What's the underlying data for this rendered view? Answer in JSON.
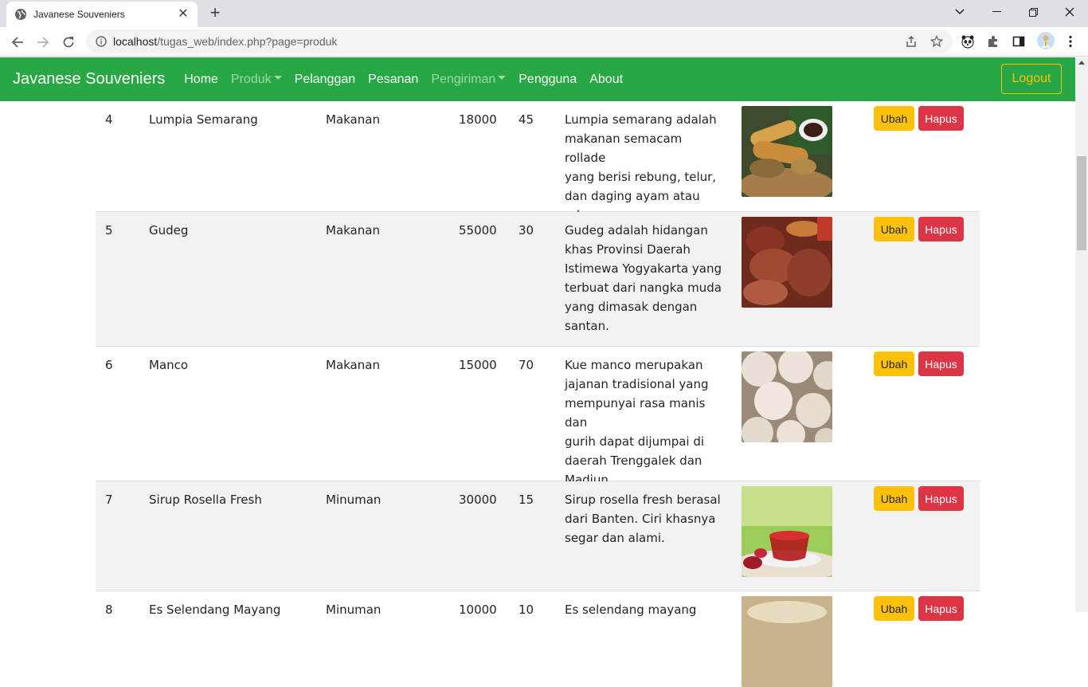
{
  "browser": {
    "tab_title": "Javanese Souveniers",
    "url_host": "localhost",
    "url_path": "/tugas_web/index.php?page=produk"
  },
  "navbar": {
    "brand": "Javanese Souveniers",
    "links": [
      "Home",
      "Produk",
      "Pelanggan",
      "Pesanan",
      "Pengiriman",
      "Pengguna",
      "About"
    ],
    "logout": "Logout",
    "accent": "#28a745"
  },
  "table": {
    "rows": [
      {
        "no": "4",
        "name": "Lumpia Semarang",
        "category": "Makanan",
        "price": "18000",
        "stock": "45",
        "desc": [
          "Lumpia semarang adalah",
          "makanan semacam rollade",
          "yang berisi rebung, telur,",
          "dan daging ayam atau",
          "udang."
        ]
      },
      {
        "no": "5",
        "name": "Gudeg",
        "category": "Makanan",
        "price": "55000",
        "stock": "30",
        "desc": [
          "Gudeg adalah hidangan",
          "khas Provinsi Daerah",
          "Istimewa Yogyakarta yang",
          "terbuat dari nangka muda",
          "yang dimasak dengan",
          "santan."
        ]
      },
      {
        "no": "6",
        "name": "Manco",
        "category": "Makanan",
        "price": "15000",
        "stock": "70",
        "desc": [
          "Kue manco merupakan",
          "jajanan tradisional yang",
          "mempunyai rasa manis dan",
          "gurih dapat dijumpai di",
          "daerah Trenggalek dan",
          "Madiun."
        ]
      },
      {
        "no": "7",
        "name": "Sirup Rosella Fresh",
        "category": "Minuman",
        "price": "30000",
        "stock": "15",
        "desc": [
          "Sirup rosella fresh berasal",
          "dari Banten. Ciri khasnya",
          "segar dan alami."
        ]
      },
      {
        "no": "8",
        "name": "Es Selendang Mayang",
        "category": "Minuman",
        "price": "10000",
        "stock": "10",
        "desc": [
          "Es selendang mayang"
        ]
      }
    ],
    "btn_ubah": "Ubah",
    "btn_hapus": "Hapus"
  }
}
